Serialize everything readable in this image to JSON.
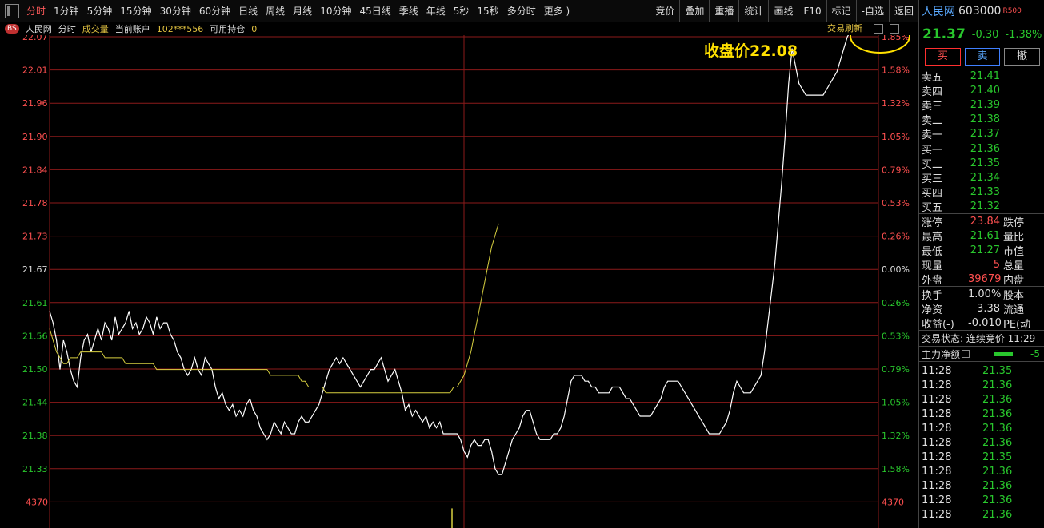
{
  "toolbar": {
    "periods": [
      "分时",
      "1分钟",
      "5分钟",
      "15分钟",
      "30分钟",
      "60分钟",
      "日线",
      "周线",
      "月线",
      "10分钟",
      "45日线",
      "季线",
      "年线",
      "5秒",
      "15秒",
      "多分时",
      "更多 )"
    ],
    "active": "分时",
    "right_buttons": [
      "竞价",
      "叠加",
      "重播",
      "统计",
      "画线",
      "F10",
      "标记",
      "-自选",
      "返回"
    ]
  },
  "infobar": {
    "badge": "BS",
    "stock": "人民网",
    "mode": "分时",
    "volume": "成交量",
    "account_label": "当前账户",
    "account": "102***556",
    "position_label": "可用持仓",
    "position": "0",
    "refresh": "交易刷新"
  },
  "annotation": "收盘价22.08",
  "colors": {
    "up": "#ff5050",
    "down": "#29c72d",
    "grid": "#8b1a1a",
    "price_line": "#ffffff",
    "avg_line": "#d8d040",
    "annotation": "#ffe000"
  },
  "chart_data": {
    "type": "line",
    "y_left_ticks": [
      "22.07",
      "22.01",
      "21.96",
      "21.90",
      "21.84",
      "21.78",
      "21.73",
      "21.67",
      "21.61",
      "21.56",
      "21.50",
      "21.44",
      "21.38",
      "21.33"
    ],
    "y_right_ticks": [
      "1.85%",
      "1.58%",
      "1.32%",
      "1.05%",
      "0.79%",
      "0.53%",
      "0.26%",
      "0.00%",
      "0.26%",
      "0.53%",
      "0.79%",
      "1.05%",
      "1.32%",
      "1.58%"
    ],
    "volume_tick": "4370",
    "ylim": [
      21.305,
      22.095
    ],
    "series": [
      {
        "values": [
          21.6,
          21.58,
          21.55,
          21.5,
          21.55,
          21.53,
          21.5,
          21.48,
          21.47,
          21.52,
          21.55,
          21.56,
          21.53,
          21.55,
          21.57,
          21.55,
          21.58,
          21.57,
          21.55,
          21.59,
          21.56,
          21.57,
          21.58,
          21.6,
          21.57,
          21.58,
          21.56,
          21.57,
          21.59,
          21.58,
          21.56,
          21.59,
          21.57,
          21.58,
          21.58,
          21.56,
          21.55,
          21.53,
          21.52,
          21.5,
          21.49,
          21.5,
          21.52,
          21.5,
          21.49,
          21.52,
          21.51,
          21.5,
          21.47,
          21.45,
          21.46,
          21.44,
          21.43,
          21.44,
          21.42,
          21.43,
          21.42,
          21.44,
          21.45,
          21.43,
          21.42,
          21.4,
          21.39,
          21.38,
          21.39,
          21.41,
          21.4,
          21.39,
          21.41,
          21.4,
          21.39,
          21.39,
          21.41,
          21.42,
          21.41,
          21.41,
          21.42,
          21.43,
          21.44,
          21.46,
          21.48,
          21.5,
          21.51,
          21.52,
          21.51,
          21.52,
          21.51,
          21.5,
          21.49,
          21.48,
          21.47,
          21.48,
          21.49,
          21.5,
          21.5,
          21.51,
          21.52,
          21.5,
          21.48,
          21.49,
          21.5,
          21.48,
          21.46,
          21.43,
          21.44,
          21.42,
          21.43,
          21.42,
          21.41,
          21.42,
          21.4,
          21.41,
          21.4,
          21.41,
          21.39,
          21.39,
          21.39,
          21.39,
          21.39,
          21.38,
          21.36,
          21.35,
          21.37,
          21.38,
          21.37,
          21.37,
          21.38,
          21.38,
          21.36,
          21.33,
          21.32,
          21.32,
          21.34,
          21.36,
          21.38,
          21.39,
          21.4,
          21.42,
          21.43,
          21.43,
          21.41,
          21.39,
          21.38,
          21.38,
          21.38,
          21.38,
          21.39,
          21.39,
          21.4,
          21.42,
          21.45,
          21.48,
          21.49,
          21.49,
          21.49,
          21.48,
          21.48,
          21.47,
          21.47,
          21.46,
          21.46,
          21.46,
          21.46,
          21.47,
          21.47,
          21.47,
          21.46,
          21.45,
          21.45,
          21.44,
          21.43,
          21.42,
          21.42,
          21.42,
          21.42,
          21.43,
          21.44,
          21.45,
          21.47,
          21.48,
          21.48,
          21.48,
          21.48,
          21.47,
          21.46,
          21.45,
          21.44,
          21.43,
          21.42,
          21.41,
          21.4,
          21.39,
          21.39,
          21.39,
          21.39,
          21.4,
          21.41,
          21.43,
          21.46,
          21.48,
          21.47,
          21.46,
          21.46,
          21.46,
          21.47,
          21.48,
          21.49,
          21.53,
          21.58,
          21.63,
          21.68,
          21.75,
          21.82,
          21.9,
          21.99,
          22.05,
          22.02,
          21.99,
          21.98,
          21.97,
          21.97,
          21.97,
          21.97,
          21.97,
          21.97,
          21.98,
          21.99,
          22.0,
          22.01,
          22.03,
          22.05,
          22.07,
          22.08
        ]
      },
      {
        "values": [
          21.57,
          21.55,
          21.53,
          21.52,
          21.51,
          21.51,
          21.52,
          21.52,
          21.52,
          21.53,
          21.53,
          21.53,
          21.53,
          21.53,
          21.53,
          21.53,
          21.52,
          21.52,
          21.52,
          21.52,
          21.52,
          21.52,
          21.51,
          21.51,
          21.51,
          21.51,
          21.51,
          21.51,
          21.51,
          21.51,
          21.51,
          21.5,
          21.5,
          21.5,
          21.5,
          21.5,
          21.5,
          21.5,
          21.5,
          21.5,
          21.5,
          21.5,
          21.5,
          21.5,
          21.5,
          21.5,
          21.5,
          21.5,
          21.5,
          21.5,
          21.5,
          21.5,
          21.5,
          21.5,
          21.5,
          21.5,
          21.5,
          21.5,
          21.5,
          21.5,
          21.5,
          21.5,
          21.5,
          21.5,
          21.49,
          21.49,
          21.49,
          21.49,
          21.49,
          21.49,
          21.49,
          21.49,
          21.49,
          21.48,
          21.48,
          21.47,
          21.47,
          21.47,
          21.47,
          21.47,
          21.46,
          21.46,
          21.46,
          21.46,
          21.46,
          21.46,
          21.46,
          21.46,
          21.46,
          21.46,
          21.46,
          21.46,
          21.46,
          21.46,
          21.46,
          21.46,
          21.46,
          21.46,
          21.46,
          21.46,
          21.46,
          21.46,
          21.46,
          21.46,
          21.46,
          21.46,
          21.46,
          21.46,
          21.46,
          21.46,
          21.46,
          21.46,
          21.46,
          21.46,
          21.46,
          21.46,
          21.46,
          21.47,
          21.47,
          21.48,
          21.49,
          21.51,
          21.53,
          21.56,
          21.59,
          21.62,
          21.65,
          21.68,
          21.71,
          21.73,
          21.75
        ]
      }
    ]
  },
  "panel": {
    "name": "人民网",
    "code": "603000",
    "tag": "R500",
    "price": "21.37",
    "change": "-0.30",
    "change_pct": "-1.38%",
    "buy": "买",
    "sell": "卖",
    "cancel": "撤",
    "asks": [
      {
        "label": "卖五",
        "price": "21.41"
      },
      {
        "label": "卖四",
        "price": "21.40"
      },
      {
        "label": "卖三",
        "price": "21.39"
      },
      {
        "label": "卖二",
        "price": "21.38"
      },
      {
        "label": "卖一",
        "price": "21.37"
      }
    ],
    "bids": [
      {
        "label": "买一",
        "price": "21.36"
      },
      {
        "label": "买二",
        "price": "21.35"
      },
      {
        "label": "买三",
        "price": "21.34"
      },
      {
        "label": "买四",
        "price": "21.33"
      },
      {
        "label": "买五",
        "price": "21.32"
      }
    ],
    "stats": [
      {
        "label": "涨停",
        "value": "23.84",
        "cls": "red",
        "label2": "跌停"
      },
      {
        "label": "最高",
        "value": "21.61",
        "cls": "green",
        "label2": "量比"
      },
      {
        "label": "最低",
        "value": "21.27",
        "cls": "green",
        "label2": "市值"
      },
      {
        "label": "现量",
        "value": "5",
        "cls": "red",
        "label2": "总量"
      },
      {
        "label": "外盘",
        "value": "39679",
        "cls": "red",
        "label2": "内盘"
      }
    ],
    "stats2": [
      {
        "label": "换手",
        "value": "1.00%",
        "label2": "股本"
      },
      {
        "label": "净资",
        "value": "3.38",
        "label2": "流通"
      },
      {
        "label": "收益(-)",
        "value": "-0.010",
        "label2": "PE(动"
      }
    ],
    "status": "交易状态: 连续竞价 11:29",
    "flow_label": "主力净额",
    "flow_value": "-5",
    "ticks": [
      {
        "time": "11:28",
        "price": "21.35"
      },
      {
        "time": "11:28",
        "price": "21.36"
      },
      {
        "time": "11:28",
        "price": "21.36"
      },
      {
        "time": "11:28",
        "price": "21.36"
      },
      {
        "time": "11:28",
        "price": "21.36"
      },
      {
        "time": "11:28",
        "price": "21.36"
      },
      {
        "time": "11:28",
        "price": "21.35"
      },
      {
        "time": "11:28",
        "price": "21.36"
      },
      {
        "time": "11:28",
        "price": "21.36"
      },
      {
        "time": "11:28",
        "price": "21.36"
      },
      {
        "time": "11:28",
        "price": "21.36"
      }
    ]
  }
}
